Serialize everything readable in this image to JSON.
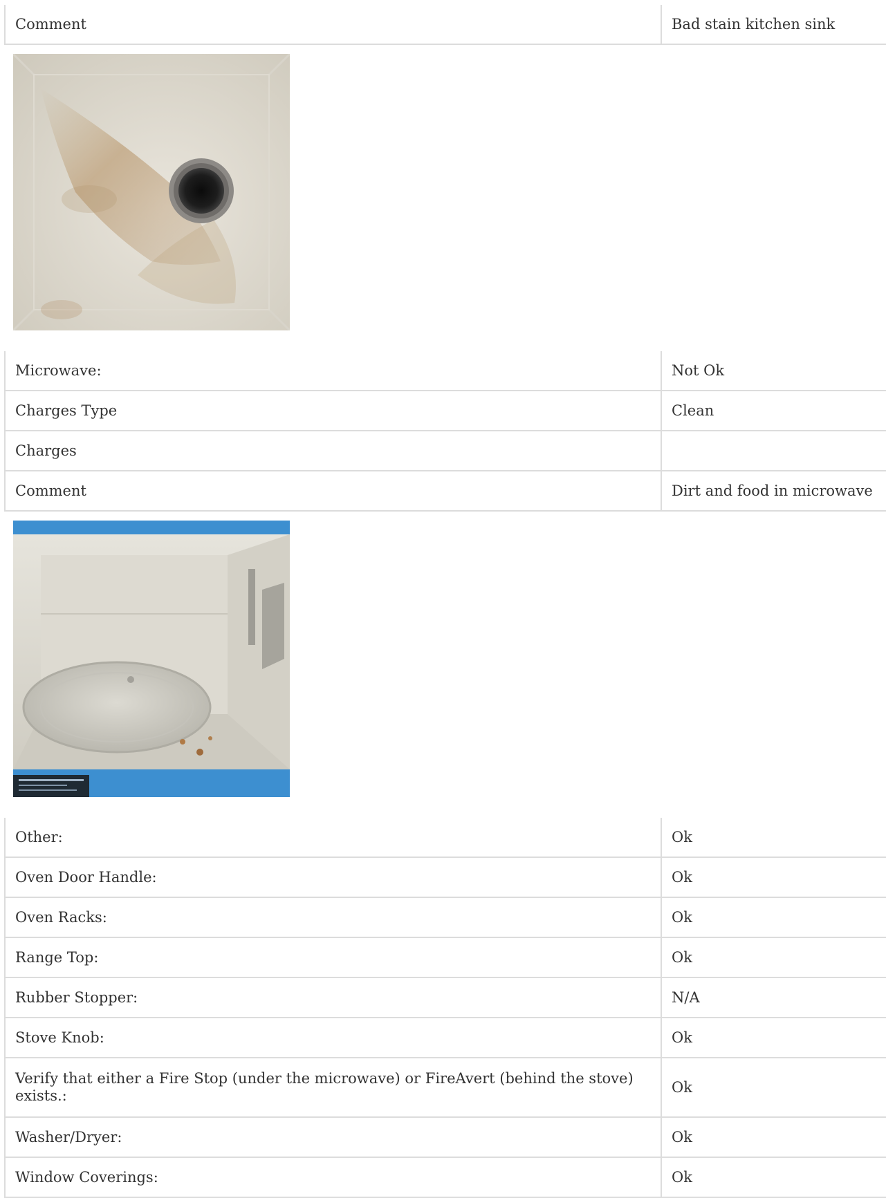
{
  "sections": [
    {
      "rows": [
        {
          "label": "Comment",
          "value": "Bad stain kitchen sink"
        }
      ],
      "photo": {
        "subject": "stained-kitchen-sink-photo"
      }
    },
    {
      "rows": [
        {
          "label": "Microwave:",
          "value": "Not Ok"
        },
        {
          "label": "Charges Type",
          "value": "Clean"
        },
        {
          "label": "Charges",
          "value": ""
        },
        {
          "label": "Comment",
          "value": "Dirt and food in microwave"
        }
      ],
      "photo": {
        "subject": "microwave-interior-photo"
      }
    },
    {
      "rows": [
        {
          "label": "Other:",
          "value": "Ok"
        },
        {
          "label": "Oven Door Handle:",
          "value": "Ok"
        },
        {
          "label": "Oven Racks:",
          "value": "Ok"
        },
        {
          "label": "Range Top:",
          "value": "Ok"
        },
        {
          "label": "Rubber Stopper:",
          "value": "N/A"
        },
        {
          "label": "Stove Knob:",
          "value": "Ok"
        },
        {
          "label": "Verify that either a Fire Stop (under the microwave) or FireAvert (behind the stove) exists.:",
          "value": "Ok"
        },
        {
          "label": "Washer/Dryer:",
          "value": "Ok"
        },
        {
          "label": "Window Coverings:",
          "value": "Ok"
        }
      ]
    }
  ]
}
